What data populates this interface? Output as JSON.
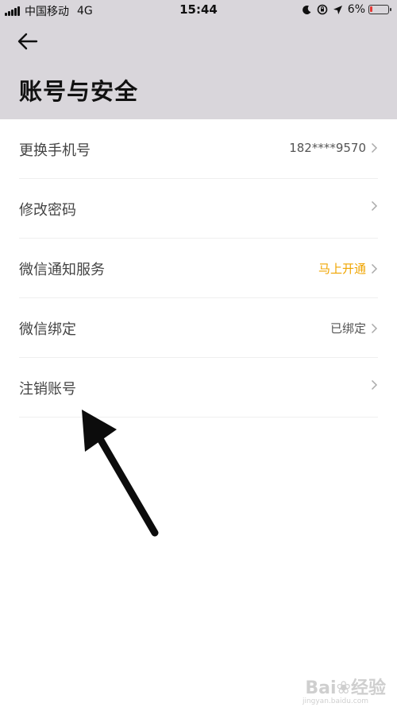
{
  "status_bar": {
    "carrier": "中国移动",
    "network": "4G",
    "time": "15:44",
    "battery_percent": "6%",
    "battery_color": "#e53935"
  },
  "header": {
    "back_icon": "arrow-left-icon",
    "title": "账号与安全",
    "background_color": "#d9d6db"
  },
  "items": [
    {
      "label": "更换手机号",
      "value": "182****9570"
    },
    {
      "label": "修改密码",
      "value": ""
    },
    {
      "label": "微信通知服务",
      "value": "马上开通",
      "value_color": "#f0a500"
    },
    {
      "label": "微信绑定",
      "value": "已绑定"
    },
    {
      "label": "注销账号",
      "value": ""
    }
  ],
  "watermark": {
    "brand": "Bai❀经验",
    "url": "jingyan.baidu.com"
  }
}
